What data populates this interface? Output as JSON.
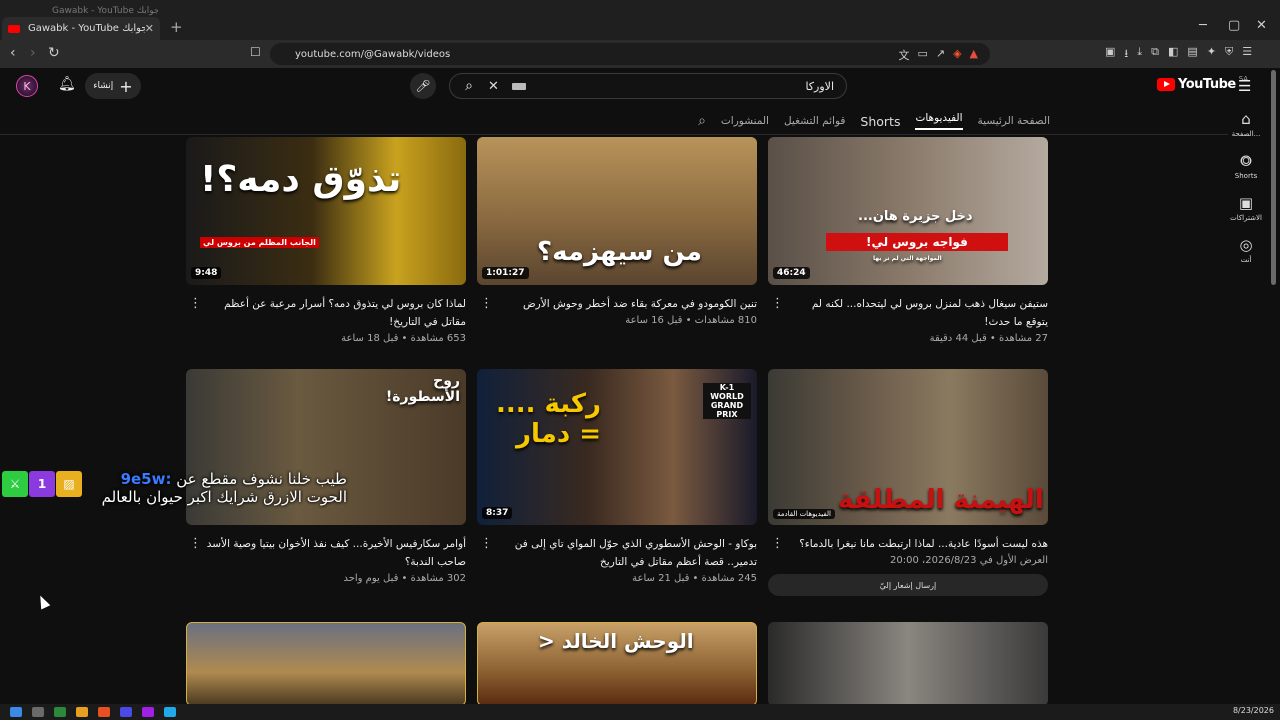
{
  "browser": {
    "ghost_tab_title": "Gawabk - YouTube جوابك",
    "active_tab_title": "Gawabk - YouTube جوابك",
    "tab_close": "✕",
    "new_tab": "+",
    "window_controls": [
      "─",
      "▢",
      "✕"
    ],
    "url": "youtube.com/@Gawabk/videos"
  },
  "header": {
    "avatar_letter": "K",
    "create_label": "إنشاء",
    "search_value": "الاوركا",
    "logo_text": "YouTube",
    "country_code": "SA"
  },
  "channel_tabs": {
    "home": "الصفحة الرئيسية",
    "videos": "الفيديوهات",
    "shorts": "Shorts",
    "playlists": "قوائم التشغيل",
    "posts": "المنشورات"
  },
  "right_rail": [
    {
      "icon": "home-icon",
      "label": "الصفحة..."
    },
    {
      "icon": "shorts-icon",
      "label": "Shorts"
    },
    {
      "icon": "subscriptions-icon",
      "label": "الاشتراكات"
    },
    {
      "icon": "you-icon",
      "label": "أنت"
    }
  ],
  "videos": [
    {
      "thumb_text": "تذوّق دمه؟!",
      "thumb_sub": "الجانب المظلم من بروس لي",
      "duration": "9:48",
      "title": "لماذا كان بروس لي يتذوق دمه؟ أسرار مرعبة عن أعظم مقاتل في التاريخ!",
      "stats": "653 مشاهدة • قبل 18 ساعة"
    },
    {
      "thumb_text": "من سيهزمه؟",
      "duration": "1:01:27",
      "title": "تنين الكومودو في معركة بقاء ضد أخطر وحوش الأرض",
      "stats": "810 مشاهدات • قبل 16 ساعة"
    },
    {
      "thumb_text": "دخل جزيرة هان...",
      "thumb_sub": "فواجه بروس لي!",
      "thumb_sub2": "المواجهة التي لم تر بها",
      "duration": "46:24",
      "title": "ستيفن سيغال ذهب لمنزل بروس لي ليتحداه... لكنه لم يتوقع ما حدث!",
      "stats": "27 مشاهدة • قبل 44 دقيقة"
    },
    {
      "thumb_text": "روح الأسطورة!",
      "duration": "",
      "title": "أوامر سكارفيس الأخيرة... كيف نفذ الأخوان بيتيا وصية الأسد صاحب الندبة؟",
      "stats": "302 مشاهدة • قبل يوم واحد"
    },
    {
      "thumb_text": "ركبة .... = دمار",
      "thumb_sub": "K-1 WORLD GRAND PRIX",
      "duration": "8:37",
      "title": "بوكاو - الوحش الأسطوري الذي حوّل المواي تاي إلى فن تدمير.. قصة أعظم مقاتل في التاريخ",
      "stats": "245 مشاهدة • قبل 21 ساعة"
    },
    {
      "thumb_text": "الهيمنة المطلقة",
      "premiere_badge": "الفيديوهات القادمة",
      "duration": "",
      "title": "هذه ليست أسودًا عادية... لماذا ارتبطت مانا نيغرا بالدماء؟",
      "stats": "العرض الأول في 2026/8/23، 20:00",
      "notify_label": "إرسال إشعار إليّ"
    },
    {
      "thumb_text": "",
      "duration": "",
      "title": "",
      "stats": ""
    },
    {
      "thumb_text": "الوحش الخالد <",
      "duration": "",
      "title": "",
      "stats": ""
    },
    {
      "thumb_text": "",
      "duration": "",
      "title": "",
      "stats": ""
    }
  ],
  "overlay_chat": {
    "username": "9e5w:",
    "line1": "طيب خلنا نشوف مقطع عن",
    "line2": "الحوت الازرق شرايك اكبر حيوان بالعالم"
  },
  "taskbar": {
    "clock": "8/23/2026"
  }
}
